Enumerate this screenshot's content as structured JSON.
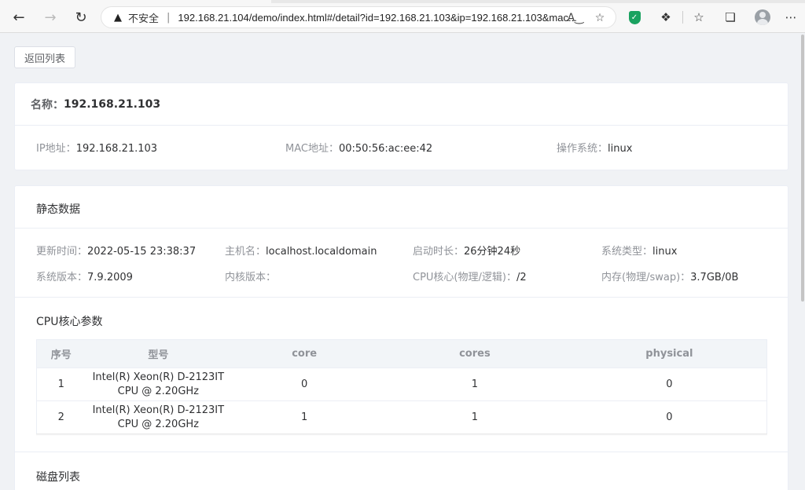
{
  "browser": {
    "insecure_label": "不安全",
    "separator": "|",
    "url": "192.168.21.104/demo/index.html#/detail?id=192.168.21.103&ip=192.168.21.103&mac..."
  },
  "page": {
    "back_button": "返回列表",
    "name_label": "名称：",
    "name_value": "192.168.21.103",
    "info": [
      {
        "key": "IP地址：",
        "value": "192.168.21.103"
      },
      {
        "key": "MAC地址：",
        "value": "00:50:56:ac:ee:42"
      },
      {
        "key": "操作系统：",
        "value": "linux"
      }
    ],
    "static_title": "静态数据",
    "static": [
      {
        "key": "更新时间：",
        "value": "2022-05-15 23:38:37"
      },
      {
        "key": "主机名：",
        "value": "localhost.localdomain"
      },
      {
        "key": "启动时长：",
        "value": "26分钟24秒"
      },
      {
        "key": "系统类型：",
        "value": "linux"
      },
      {
        "key": "系统版本：",
        "value": "7.9.2009"
      },
      {
        "key": "内核版本：",
        "value": ""
      },
      {
        "key": "CPU核心(物理/逻辑)：",
        "value": "/2"
      },
      {
        "key": "内存(物理/swap)：",
        "value": "3.7GB/0B"
      }
    ],
    "cpu_title": "CPU核心参数",
    "cpu_table": {
      "headers": [
        "序号",
        "型号",
        "core",
        "cores",
        "physical"
      ],
      "rows": [
        [
          "1",
          "Intel(R) Xeon(R) D-2123IT CPU @ 2.20GHz",
          "0",
          "1",
          "0"
        ],
        [
          "2",
          "Intel(R) Xeon(R) D-2123IT CPU @ 2.20GHz",
          "1",
          "1",
          "0"
        ]
      ]
    },
    "disk_title": "磁盘列表"
  },
  "colors": {
    "accent_green": "#1aa260",
    "label_gray": "#909399",
    "text_dark": "#303133"
  }
}
